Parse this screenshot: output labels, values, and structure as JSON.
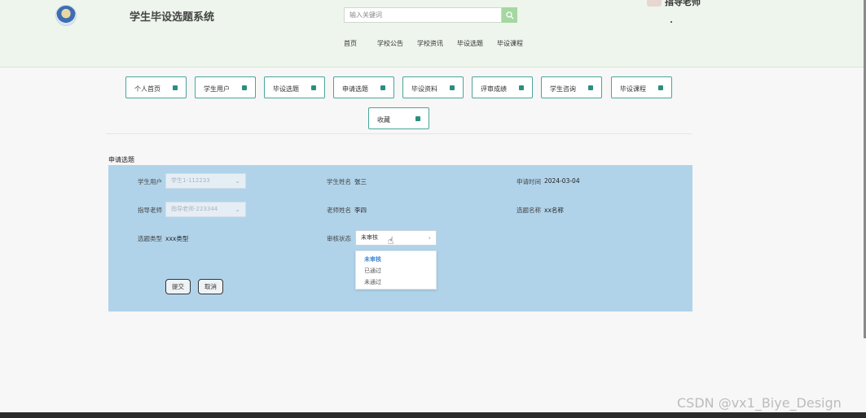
{
  "header": {
    "site_title": "学生毕设选题系统",
    "search_placeholder": "输入关键词",
    "user_name": "指导老师"
  },
  "top_nav": [
    "首页",
    "学校公告",
    "学校资讯",
    "毕设选题",
    "毕设课程"
  ],
  "menu": [
    "个人首页",
    "学生用户",
    "毕设选题",
    "申请选题",
    "毕设资料",
    "评审成绩",
    "学生咨询",
    "毕设课程",
    "收藏"
  ],
  "form": {
    "section_title": "申请选题",
    "student_user_label": "学生用户",
    "student_user_value": "学生1-112233",
    "student_name_label": "学生姓名",
    "student_name_value": "张三",
    "apply_time_label": "申请时间",
    "apply_time_value": "2024-03-04",
    "advisor_label": "指导老师",
    "advisor_value": "指导老师-223344",
    "teacher_name_label": "老师姓名",
    "teacher_name_value": "李四",
    "topic_name_label": "选题名称",
    "topic_name_value": "xx名称",
    "topic_type_label": "选题类型",
    "topic_type_value": "xxx类型",
    "review_status_label": "审核状态",
    "review_status_value": "未审核",
    "review_options": [
      "未审核",
      "已通过",
      "未通过"
    ],
    "submit_label": "提交",
    "cancel_label": "取消"
  },
  "watermark": "CSDN @vx1_Biye_Design",
  "colors": {
    "header_bg": "#eef5ec",
    "accent_teal": "#4aa59a",
    "panel_bg": "#b0d3ea",
    "selected_option": "#3d88d6"
  }
}
